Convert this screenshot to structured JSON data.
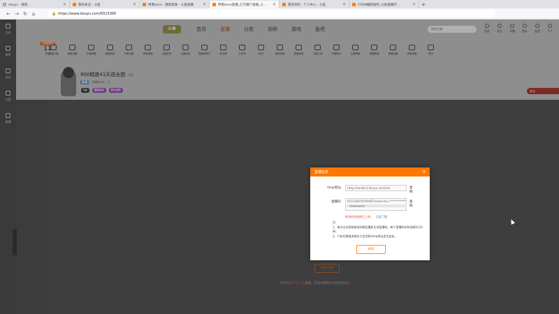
{
  "browser": {
    "tabs": [
      {
        "title": "douyu - 搜索",
        "active": false
      },
      {
        "title": "我的关注 - 斗鱼",
        "active": false
      },
      {
        "title": "柯南zone - 搜索结果 - 斗鱼直播",
        "active": false
      },
      {
        "title": "柯南zone直播_亿万播户直播_斗...",
        "active": true
      },
      {
        "title": "我的资料 - 个人中心 - 斗鱼",
        "active": false
      },
      {
        "title": "CSDN编程福利_斗鱼直播开...",
        "active": false
      }
    ],
    "new_tab": "+",
    "url": "https://www.douyu.com/6515360"
  },
  "rail": {
    "items": [
      "主站",
      "推荐",
      "关注",
      "分类",
      "直播"
    ]
  },
  "topnav": {
    "logo": "斗鱼",
    "items": [
      "首页",
      "直播",
      "分类",
      "视频",
      "游戏",
      "鱼吧"
    ],
    "active_index": 1,
    "search_placeholder": "搜索主播",
    "user_items": [
      "历史",
      "关注",
      "开播",
      "鱼丸",
      "会员",
      "个人"
    ]
  },
  "streak": {
    "pill": "已连续签到",
    "days": "11",
    "label": "签到"
  },
  "toolbar_icons": [
    "直播开播",
    "弹幕设置",
    "开播提醒",
    "直播信息",
    "分类设置",
    "房间管理",
    "主播任务",
    "主播权益",
    "直播间排行",
    "粉丝团",
    "云游戏",
    "推流",
    "视频投稿",
    "直播回放",
    "主播工具",
    "开播助手",
    "主播等级",
    "直播数据",
    "直播设置",
    "房管设置",
    "更多"
  ],
  "room": {
    "title": "900精度41天选全图",
    "title_extra": "举报",
    "owner": "柯南zone",
    "category_tag": "英雄",
    "meta": "0",
    "badges": [
      "0级",
      "碧蓝航线",
      "暂无钻粉"
    ],
    "follow_label": "关注"
  },
  "player": {
    "open_button": "我要开播",
    "hint_prefix": "您还可以",
    "hint_link": "下载斗鱼",
    "hint_suffix": "直播，获得海量精彩的观赏体验"
  },
  "modal": {
    "title": "直播信息",
    "close": "×",
    "rtmp_label": "rtmp地址:",
    "rtmp_value": "rtmp://sendtc3.douyu.com/live",
    "copy1": "复制",
    "key_label": "直播码:",
    "key_value": "6515360rf5fOAMZ?wsSecret=****************",
    "copy2": "复制",
    "warn": "推流码有效期已上线。",
    "warn_link": "点此了解",
    "note_title": "注：",
    "note1": "1、每次点击获取推流码都会重新生成直播码，每个直播码的有效期为3分钟。",
    "note2": "2、只有切换推流域名才会导致rtmp地址发生变化。",
    "ok_button": "关闭"
  }
}
